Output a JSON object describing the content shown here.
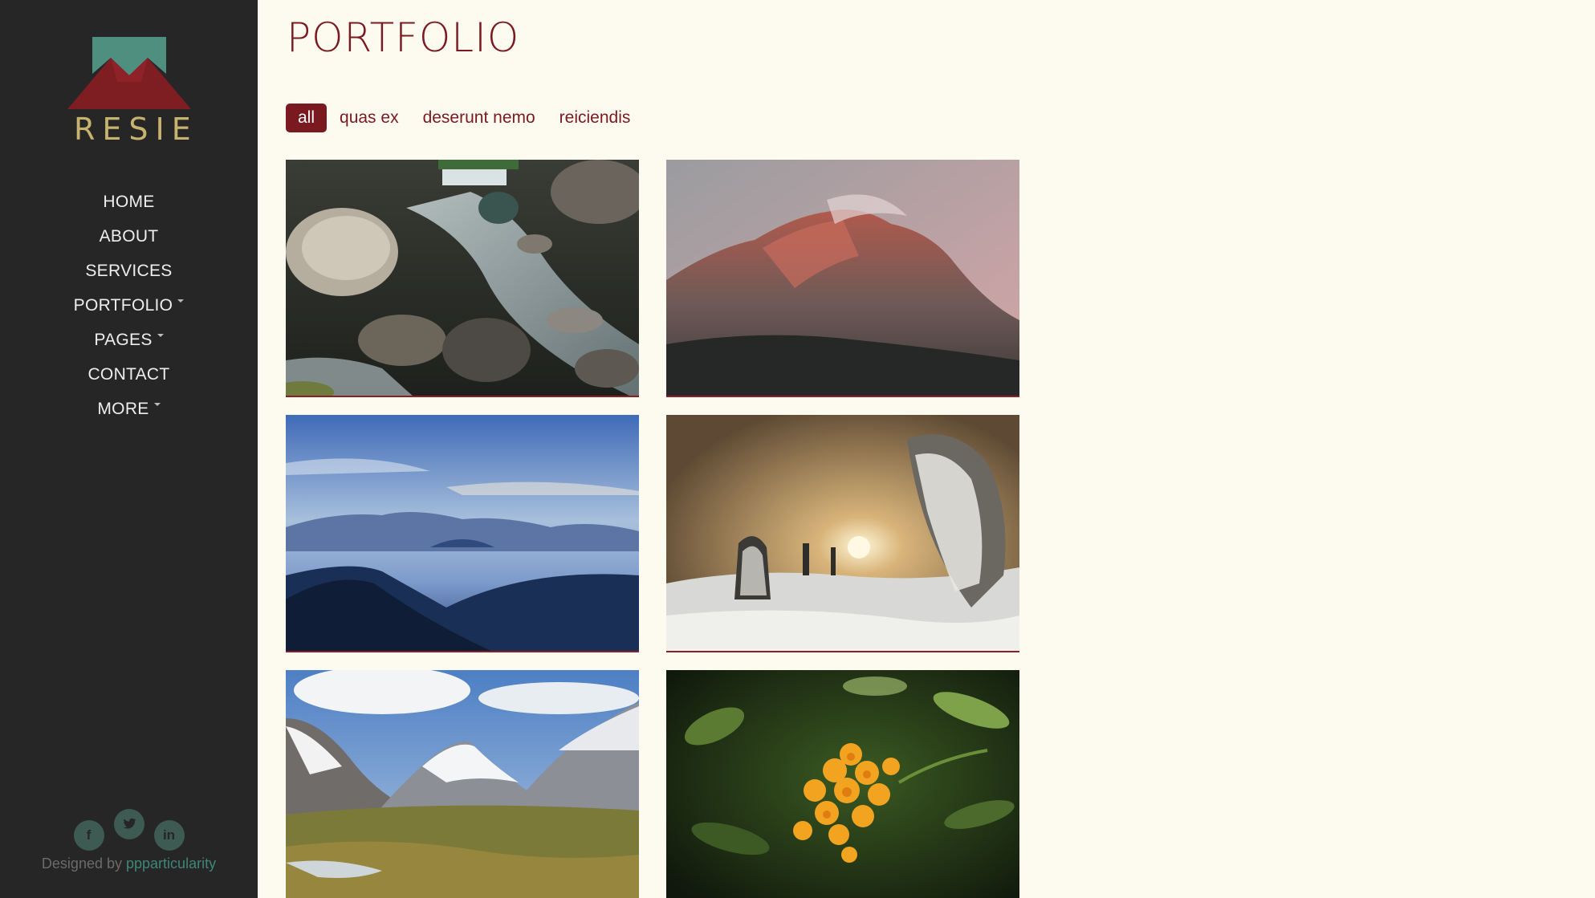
{
  "brand": {
    "name": "RESIE"
  },
  "nav": {
    "items": [
      {
        "label": "HOME",
        "dropdown": false
      },
      {
        "label": "ABOUT",
        "dropdown": false
      },
      {
        "label": "SERVICES",
        "dropdown": false
      },
      {
        "label": "PORTFOLIO",
        "dropdown": true
      },
      {
        "label": "PAGES",
        "dropdown": true
      },
      {
        "label": "CONTACT",
        "dropdown": false
      },
      {
        "label": "MORE",
        "dropdown": true
      }
    ]
  },
  "social": {
    "facebook": "f",
    "twitter": "t",
    "linkedin": "in"
  },
  "footer": {
    "credit_prefix": "Designed by",
    "credit_link": "ppparticularity"
  },
  "page": {
    "title": "PORTFOLIO"
  },
  "filters": [
    {
      "label": "all",
      "active": true
    },
    {
      "label": "quas ex",
      "active": false
    },
    {
      "label": "deserunt nemo",
      "active": false
    },
    {
      "label": "reiciendis",
      "active": false
    }
  ],
  "gallery": [
    {
      "subject": "river-rocks"
    },
    {
      "subject": "red-mountain"
    },
    {
      "subject": "blue-mountains"
    },
    {
      "subject": "snow-forest"
    },
    {
      "subject": "alpine-valley"
    },
    {
      "subject": "orange-orchid"
    }
  ],
  "colors": {
    "accent": "#7a1a20",
    "sidebar": "#262626",
    "background": "#fdfbf0",
    "logo_gold": "#c7b36e",
    "social_green": "#3d5b52",
    "link_green": "#3f8677"
  },
  "icons": [
    "mountain-logo-icon",
    "facebook-icon",
    "twitter-icon",
    "linkedin-icon",
    "caret-down-icon"
  ]
}
